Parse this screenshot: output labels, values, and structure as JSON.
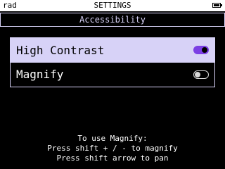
{
  "status_bar": {
    "left_text": "rad",
    "title": "SETTINGS",
    "battery_icon": "battery-icon"
  },
  "header": {
    "title": "Accessibility"
  },
  "settings": [
    {
      "label": "High Contrast",
      "enabled": true,
      "selected": true
    },
    {
      "label": "Magnify",
      "enabled": false,
      "selected": false
    }
  ],
  "help": {
    "line1": "To use Magnify:",
    "line2": "Press shift + / - to magnify",
    "line3": "Press shift arrow to pan"
  },
  "colors": {
    "accent": "#d7d2f7",
    "toggle_on": "#7b3fe4",
    "background": "#000000",
    "status_bar": "#ffffff"
  }
}
